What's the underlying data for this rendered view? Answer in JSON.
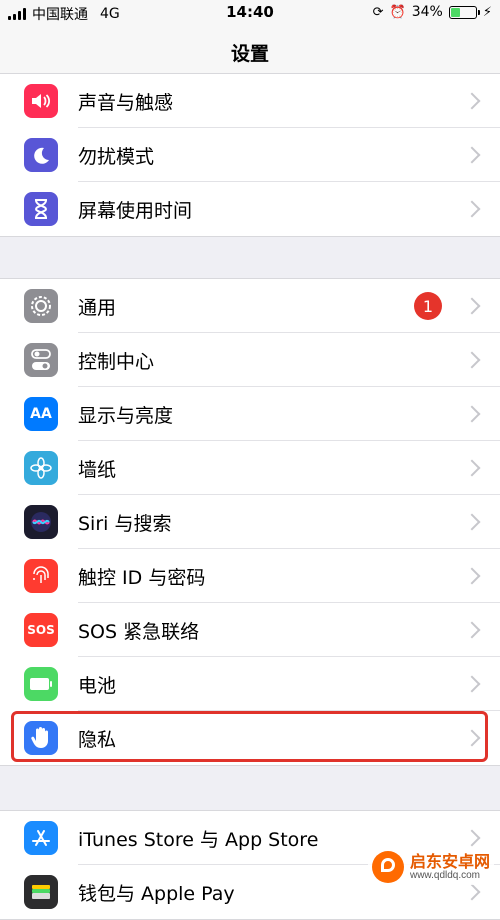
{
  "status": {
    "carrier": "中国联通",
    "network": "4G",
    "time": "14:40",
    "battery": "34%",
    "battery_level": 0.34
  },
  "nav": {
    "title": "设置"
  },
  "groups": [
    {
      "rows": [
        {
          "label": "声音与触感",
          "icon": "speaker-icon",
          "color": "#ff2d55"
        },
        {
          "label": "勿扰模式",
          "icon": "moon-icon",
          "color": "#5856d6"
        },
        {
          "label": "屏幕使用时间",
          "icon": "hourglass-icon",
          "color": "#5856d6"
        }
      ]
    },
    {
      "rows": [
        {
          "label": "通用",
          "icon": "gear-icon",
          "color": "#8e8e93",
          "badge": "1"
        },
        {
          "label": "控制中心",
          "icon": "toggles-icon",
          "color": "#8e8e93"
        },
        {
          "label": "显示与亮度",
          "icon": "text-size-icon",
          "color": "#007aff",
          "glyph": "AA"
        },
        {
          "label": "墙纸",
          "icon": "flower-icon",
          "color": "#34aadc"
        },
        {
          "label": "Siri 与搜索",
          "icon": "siri-icon",
          "color": "#1c1c2e"
        },
        {
          "label": "触控 ID 与密码",
          "icon": "fingerprint-icon",
          "color": "#ff3b30"
        },
        {
          "label": "SOS 紧急联络",
          "icon": "sos-icon",
          "color": "#ff3b30",
          "glyph": "SOS"
        },
        {
          "label": "电池",
          "icon": "battery-icon",
          "color": "#4cd964"
        },
        {
          "label": "隐私",
          "icon": "hand-icon",
          "color": "#3478f6"
        }
      ]
    },
    {
      "rows": [
        {
          "label": "iTunes Store 与 App Store",
          "icon": "app-store-icon",
          "color": "#1a8cff"
        },
        {
          "label": "钱包与 Apple Pay",
          "icon": "wallet-icon",
          "color": "#2c2c2e"
        }
      ]
    }
  ],
  "watermark": {
    "name": "启东安卓网",
    "url": "www.qdldq.com"
  },
  "colors": {
    "accent": "#007aff",
    "highlight": "#e0332b",
    "badge": "#e5342b"
  }
}
